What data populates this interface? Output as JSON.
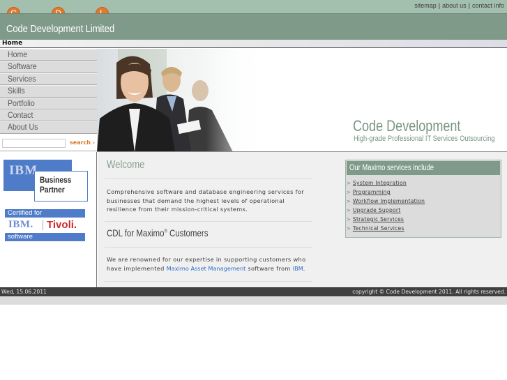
{
  "header": {
    "logo_letters": [
      "C",
      "D",
      "L"
    ],
    "logo_text": "Code Development Limited",
    "accent_color": "#e2792b",
    "links": [
      {
        "label": "sitemap"
      },
      {
        "label": "about us"
      },
      {
        "label": "contact info"
      }
    ],
    "separator": "|"
  },
  "breadcrumb": {
    "current": "Home"
  },
  "nav": {
    "items": [
      {
        "label": "Home"
      },
      {
        "label": "Software"
      },
      {
        "label": "Services"
      },
      {
        "label": "Skills"
      },
      {
        "label": "Portfolio"
      },
      {
        "label": "Contact"
      },
      {
        "label": "About Us"
      }
    ]
  },
  "search": {
    "value": "",
    "placeholder": "",
    "button_label": "search ›"
  },
  "partner_logos": {
    "ibm": "IBM",
    "business_partner_line1": "Business",
    "business_partner_line2": "Partner",
    "certified_for": "Certified for",
    "ibm_short": "IBM.",
    "tivoli": "Tivoli.",
    "software": "software"
  },
  "banner": {
    "title": "Code Development",
    "subtitle": "High-grade Professional IT Services Outsourcing"
  },
  "main": {
    "welcome_title": "Welcome",
    "welcome_text": "Comprehensive software and database engineering services for businesses that demand the highest levels of operational resilience from their mission-critical systems.",
    "cdl_title_prefix": "CDL for Maximo",
    "cdl_title_reg": "®",
    "cdl_title_suffix": " Customers",
    "cdl_text_1": "We are renowned for our expertise in supporting customers who have implemented ",
    "cdl_link_1": "Maximo Asset Management",
    "cdl_text_2": " software from ",
    "cdl_link_2": "IBM",
    "cdl_text_3": "."
  },
  "services_box": {
    "title": "Our Maximo services include",
    "items": [
      {
        "label": "System Integration"
      },
      {
        "label": "Programming"
      },
      {
        "label": "Workflow Implementation"
      },
      {
        "label": "Upgrade Support"
      },
      {
        "label": "Strategic Services"
      },
      {
        "label": "Technical Services"
      }
    ]
  },
  "footer": {
    "date": "Wed, 15.06.2011",
    "copyright": "copyright © Code Development 2011. All rights reserved."
  }
}
